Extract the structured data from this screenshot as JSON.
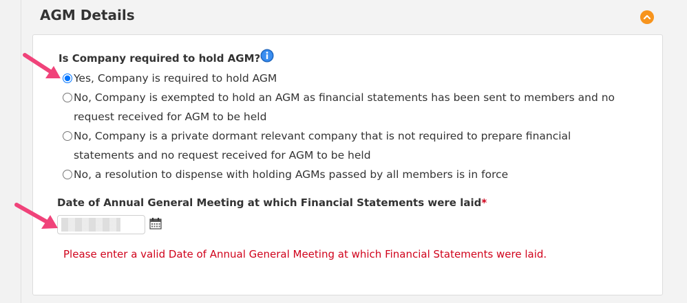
{
  "section": {
    "title": "AGM Details"
  },
  "question": {
    "label": "Is Company required to hold AGM?",
    "required_mark": "*",
    "options": [
      {
        "label": "Yes, Company is required to hold AGM",
        "selected": true
      },
      {
        "label": "No, Company is exempted to hold an AGM as financial statements has been sent to members and no request received for AGM to be held",
        "selected": false
      },
      {
        "label": "No, Company is a private dormant relevant company that is not required to prepare financial statements and no request received for AGM to be held",
        "selected": false
      },
      {
        "label": "No, a resolution to dispense with holding AGMs passed by all members is in force",
        "selected": false
      }
    ]
  },
  "date_field": {
    "label": "Date of Annual General Meeting at which Financial Statements were laid",
    "required_mark": "*",
    "value": "",
    "error": "Please enter a valid Date of Annual General Meeting at which Financial Statements were laid."
  },
  "colors": {
    "accent_orange": "#f7941d",
    "error_red": "#d0021b",
    "annotation_pink": "#f0437a",
    "info_blue": "#2a7de1"
  },
  "icons": {
    "collapse": "chevron-up-icon",
    "info": "info-icon",
    "calendar": "calendar-icon",
    "annotation": "arrow-annotation-icon"
  }
}
